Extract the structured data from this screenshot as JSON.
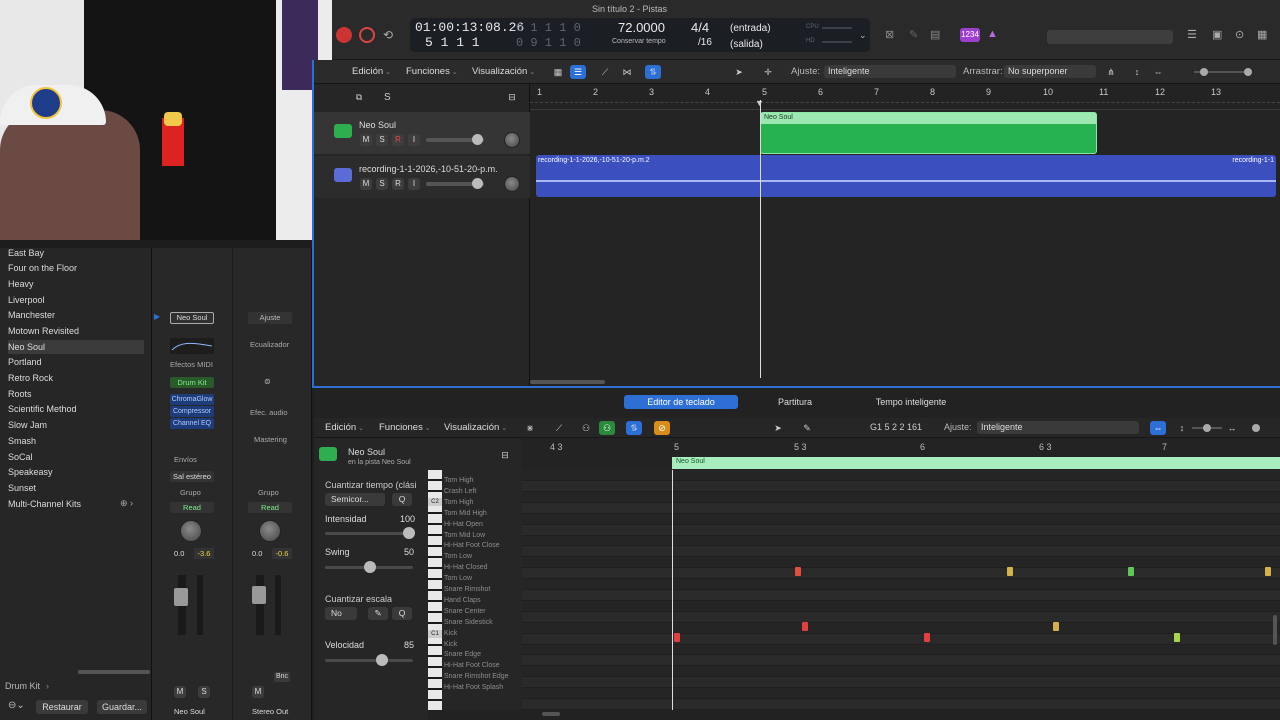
{
  "window": {
    "title": "Sin título 2 - Pistas"
  },
  "lcd": {
    "timecode": "01:00:13:08.26",
    "bars": "5  1  1    1",
    "dim_a": "0  1  1  1  0",
    "dim_b": "0  9  1  1  0",
    "tempo": "72.0000",
    "tempo_label": "Conservar tempo",
    "sig_top": "4/4",
    "sig_bot": "/16",
    "in": "(entrada)",
    "out": "(salida)",
    "cpu": "CPU",
    "hd": "HD"
  },
  "badge": "1234",
  "toolbar": {
    "edit": "Edición",
    "functions": "Funciones",
    "view": "Visualización",
    "snap_label": "Ajuste:",
    "snap_value": "Inteligente",
    "drag_label": "Arrastrar:",
    "drag_value": "No superponer"
  },
  "track_header": {
    "s": "S"
  },
  "tracks": [
    {
      "name": "Neo Soul",
      "m": "M",
      "s": "S",
      "r": "R",
      "i": "I"
    },
    {
      "name": "recording-1-1-2026,-10-51-20-p.m.",
      "m": "M",
      "s": "S",
      "r": "R",
      "i": "I"
    }
  ],
  "ruler": [
    "1",
    "2",
    "3",
    "4",
    "5",
    "6",
    "7",
    "8",
    "9",
    "10",
    "11",
    "12",
    "13"
  ],
  "regions": {
    "drum": "Neo Soul",
    "audio": "recording-1-1-2026,-10-51-20-p.m.2",
    "audio_end": "recording-1-1"
  },
  "library": {
    "items": [
      "East Bay",
      "Four on the Floor",
      "Heavy",
      "Liverpool",
      "Manchester",
      "Motown Revisited",
      "Neo Soul",
      "Portland",
      "Retro Rock",
      "Roots",
      "Scientific Method",
      "Slow Jam",
      "Smash",
      "SoCal",
      "Speakeasy",
      "Sunset",
      "Multi-Channel Kits"
    ],
    "selected": "Neo Soul",
    "footer_path": "Drum Kit",
    "restore": "Restaurar",
    "save": "Guardar..."
  },
  "mixer": {
    "ch1": {
      "name": "Neo Soul",
      "midi_fx": "Efectos MIDI",
      "instrument": "Drum Kit",
      "fx": [
        "ChromaGlow",
        "Compressor",
        "Channel EQ"
      ],
      "sends": "Envíos",
      "output": "Sal estéreo",
      "group": "Grupo",
      "auto": "Read",
      "pan_a": "0.0",
      "pan_b": "-3.6",
      "m": "M",
      "s": "S",
      "footer": "Neo Soul"
    },
    "ch2": {
      "setting": "Ajuste",
      "eq": "Ecualizador",
      "fx": "Efec. audio",
      "mastering": "Mastering",
      "group": "Grupo",
      "auto": "Read",
      "pan_a": "0.0",
      "pan_b": "-0.6",
      "m": "M",
      "bnc": "Bnc",
      "footer": "Stereo Out"
    }
  },
  "editor_tabs": [
    "Editor de teclado",
    "Partitura",
    "Tempo inteligente"
  ],
  "editor": {
    "edit": "Edición",
    "functions": "Funciones",
    "view": "Visualización",
    "pos": "G1  5 2 2 161",
    "snap_label": "Ajuste:",
    "snap_value": "Inteligente",
    "region": "Neo Soul",
    "track": "en la pista Neo Soul",
    "ruler": [
      "4 3",
      "5",
      "5 3",
      "6",
      "6 3",
      "7"
    ],
    "region_tag": "Neo Soul"
  },
  "quantize": {
    "title": "Cuantizar tiempo (clási",
    "value": "Semicor...",
    "q": "Q",
    "strength_label": "Intensidad",
    "strength": "100",
    "swing_label": "Swing",
    "swing": "50",
    "scale_title": "Cuantizar escala",
    "scale_value": "No",
    "q2": "Q",
    "vel_label": "Velocidad",
    "vel": "85"
  },
  "keys": {
    "names": [
      "Tom High",
      "Crash Left",
      "Tom High",
      "Tom Mid High",
      "Hi-Hat Open",
      "Tom Mid Low",
      "Hi-Hat Foot Close",
      "Tom Low",
      "Hi-Hat Closed",
      "Tom Low",
      "Snare Rimshot",
      "Hand Claps",
      "Snare Center",
      "Snare Sidestick",
      "Kick",
      "Kick",
      "Snare Edge",
      "Hi-Hat Foot Close",
      "Snare Rimshot Edge",
      "Hi-Hat Foot Splash"
    ],
    "c2": "C2",
    "c1": "C1"
  },
  "notes": [
    {
      "row": 8,
      "beat": 0.36,
      "color": "#e0503a"
    },
    {
      "row": 8,
      "beat": 0.64,
      "color": "#d6b04a"
    },
    {
      "row": 8,
      "beat": 0.8,
      "color": "#5cc85c"
    },
    {
      "row": 8,
      "beat": 0.98,
      "color": "#d6b04a"
    },
    {
      "row": 13,
      "beat": 0.37,
      "color": "#e04040"
    },
    {
      "row": 13,
      "beat": 0.7,
      "color": "#d6b04a"
    },
    {
      "row": 14,
      "beat": 0.2,
      "color": "#e04040"
    },
    {
      "row": 14,
      "beat": 0.53,
      "color": "#e04040"
    },
    {
      "row": 14,
      "beat": 0.86,
      "color": "#a8d64a"
    }
  ]
}
